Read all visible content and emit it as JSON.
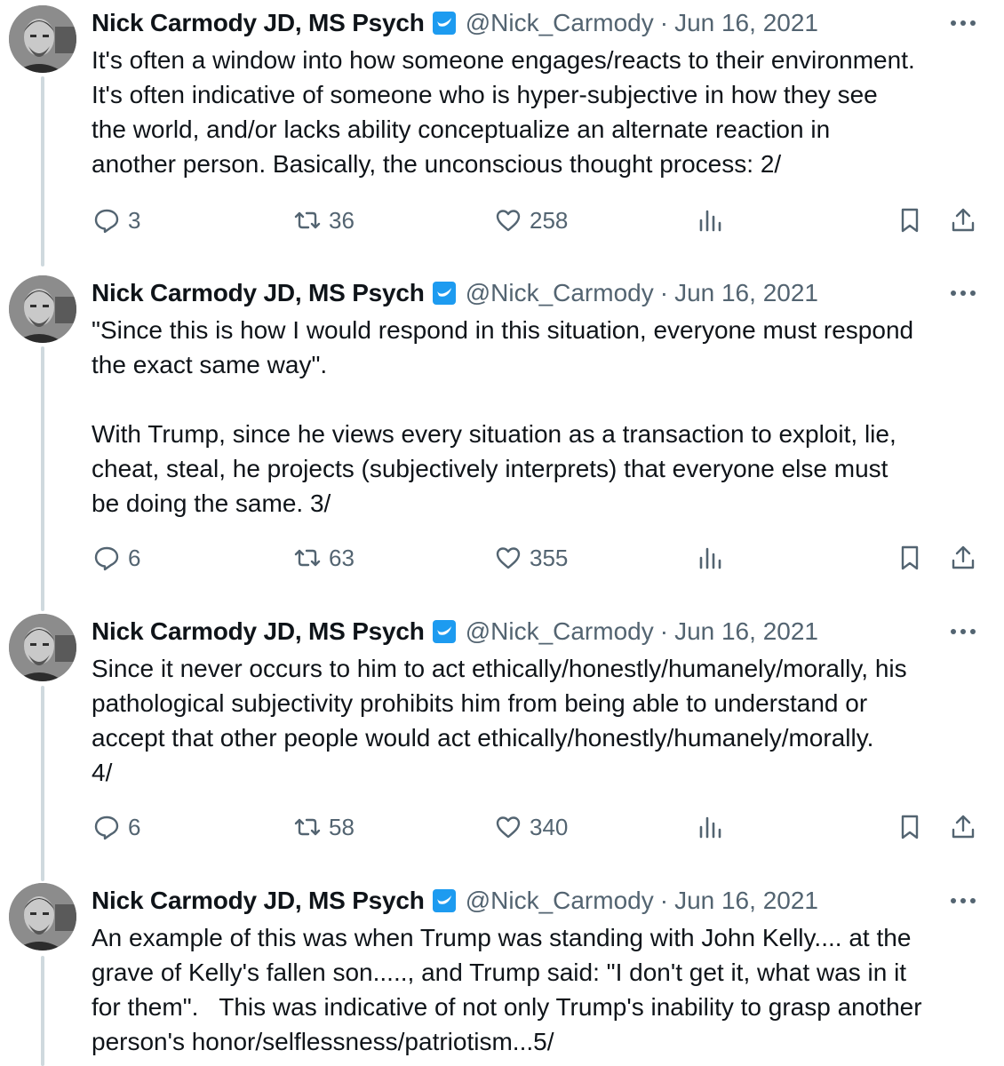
{
  "tweets": [
    {
      "name": "Nick Carmody JD, MS Psych",
      "handle": "@Nick_Carmody",
      "separator": "·",
      "date": "Jun 16, 2021",
      "text": "It's often a window into how someone engages/reacts to their environment.\nIt's often indicative of someone who is hyper-subjective in how they see\nthe world, and/or lacks ability conceptualize an alternate reaction in\nanother person. Basically, the unconscious thought process: 2/",
      "replies": "3",
      "retweets": "36",
      "likes": "258"
    },
    {
      "name": "Nick Carmody JD, MS Psych",
      "handle": "@Nick_Carmody",
      "separator": "·",
      "date": "Jun 16, 2021",
      "text": "\"Since this is how I would respond in this situation, everyone must respond\nthe exact same way\".\n\nWith Trump, since he views every situation as a transaction to exploit, lie,\ncheat, steal, he projects (subjectively interprets) that everyone else must\nbe doing the same. 3/",
      "replies": "6",
      "retweets": "63",
      "likes": "355"
    },
    {
      "name": "Nick Carmody JD, MS Psych",
      "handle": "@Nick_Carmody",
      "separator": "·",
      "date": "Jun 16, 2021",
      "text": "Since it never occurs to him to act ethically/honestly/humanely/morally, his\npathological subjectivity prohibits him from being able to understand or\naccept that other people would act ethically/honestly/humanely/morally.\n4/",
      "replies": "6",
      "retweets": "58",
      "likes": "340"
    },
    {
      "name": "Nick Carmody JD, MS Psych",
      "handle": "@Nick_Carmody",
      "separator": "·",
      "date": "Jun 16, 2021",
      "text": "An example of this was when Trump was standing with John Kelly.... at the\ngrave of Kelly's fallen son....., and Trump said: \"I don't get it, what was in it\nfor them\".   This was indicative of not only Trump's inability to grasp another\nperson's honor/selflessness/patriotism...5/"
    }
  ],
  "colors": {
    "text": "#0f1419",
    "muted": "#536471",
    "verified": "#1d9bf0",
    "thread_line": "#cfd9de"
  },
  "icons": [
    "reply-icon",
    "retweet-icon",
    "like-icon",
    "views-icon",
    "bookmark-icon",
    "share-icon",
    "more-icon",
    "verified-icon"
  ]
}
